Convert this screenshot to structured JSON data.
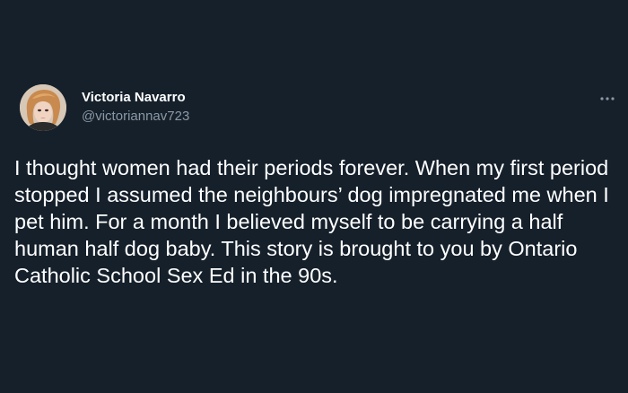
{
  "tweet": {
    "author": {
      "display_name": "Victoria Navarro",
      "handle": "@victoriannav723"
    },
    "text": "I thought women had their periods forever. When my first period stopped I assumed the neighbours’ dog impregnated me when I pet him. For a month I believed myself to be carrying a half human half dog baby. This story is brought to you by Ontario Catholic School Sex Ed in the 90s."
  },
  "icons": {
    "more": "more-horizontal-icon",
    "avatar": "profile-photo"
  },
  "colors": {
    "background": "#15202b",
    "text_primary": "#ffffff",
    "text_secondary": "#8b98a5"
  }
}
